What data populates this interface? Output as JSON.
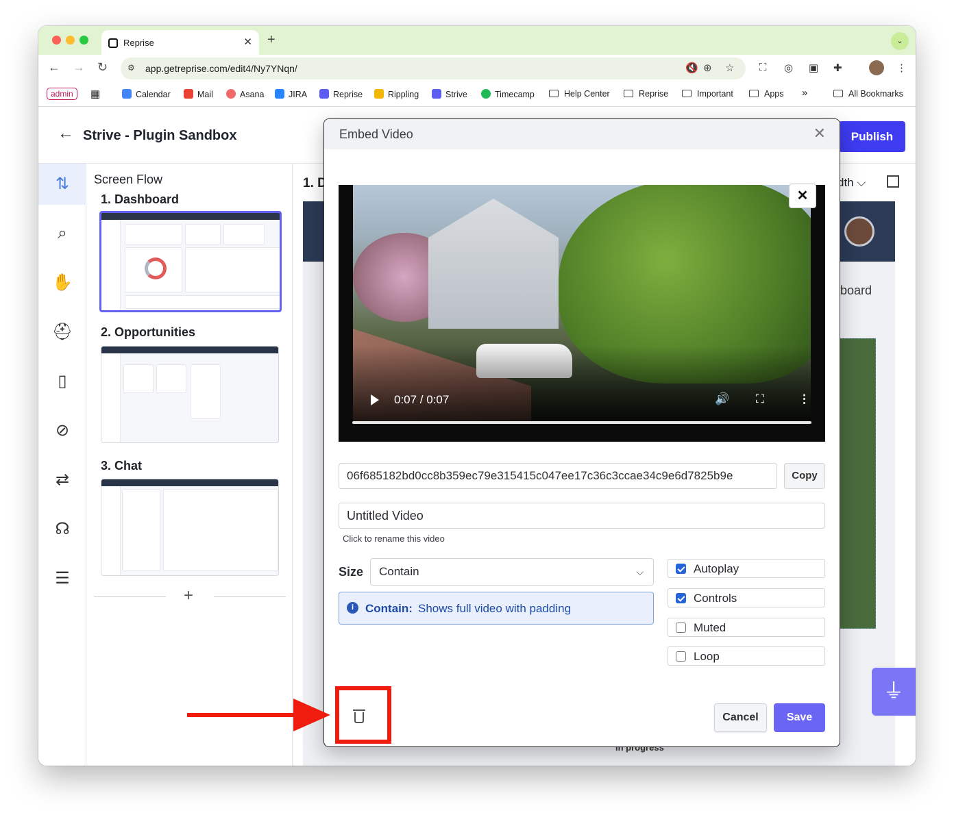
{
  "browser": {
    "tab_title": "Reprise",
    "tab_close": "✕",
    "new_tab": "+",
    "url": "app.getreprise.com/edit4/Ny7YNqn/",
    "bookmarks": [
      {
        "label": "Calendar",
        "icon": "calendar-icon",
        "color": "#4285f4"
      },
      {
        "label": "Mail",
        "icon": "gmail-icon",
        "color": "#ea4335"
      },
      {
        "label": "Asana",
        "icon": "asana-icon",
        "color": "#f06a6a"
      },
      {
        "label": "JIRA",
        "icon": "jira-icon",
        "color": "#2684ff"
      },
      {
        "label": "Reprise",
        "icon": "reprise-icon",
        "color": "#5b5ef0"
      },
      {
        "label": "Rippling",
        "icon": "rippling-icon",
        "color": "#f2b705"
      },
      {
        "label": "Strive",
        "icon": "strive-icon",
        "color": "#5b5ef0"
      },
      {
        "label": "Timecamp",
        "icon": "timecamp-icon",
        "color": "#1db954"
      },
      {
        "label": "Help Center",
        "icon": "folder-icon"
      },
      {
        "label": "Reprise",
        "icon": "folder-icon"
      },
      {
        "label": "Important",
        "icon": "folder-icon"
      },
      {
        "label": "Apps",
        "icon": "folder-icon"
      }
    ],
    "bookmarks_overflow": "»",
    "all_bookmarks": "All Bookmarks",
    "admin_chip": "admin"
  },
  "app": {
    "back": "←",
    "title": "Strive - Plugin Sandbox",
    "publish_label": "Publish",
    "flow_title": "Screen Flow",
    "screens": [
      {
        "label": "1. Dashboard"
      },
      {
        "label": "2. Opportunities"
      },
      {
        "label": "3. Chat"
      }
    ],
    "add_screen": "+",
    "canvas_title": "1. D",
    "canvas_width": "dth ⌵",
    "preview_text": "board",
    "preview_status": "In progress",
    "rail_icons": [
      "reorder-icon",
      "search-icon",
      "hand-shake-icon",
      "helmet-icon",
      "mobile-icon",
      "eye-off-icon",
      "swap-icon",
      "support-icon",
      "list-tree-icon"
    ]
  },
  "modal": {
    "title": "Embed Video",
    "close": "✕",
    "video": {
      "time": "0:07 / 0:07",
      "close_overlay": "✕",
      "volume": "🔊",
      "fullscreen": "⛶",
      "more": "⋮"
    },
    "hash_value": "06f685182bd0cc8b359ec79e315415c047ee17c36c3ccae34c9e6d7825b9e",
    "copy_label": "Copy",
    "name_value": "Untitled Video",
    "rename_hint": "Click to rename this video",
    "size_label": "Size",
    "size_value": "Contain",
    "size_chevron": "⌵",
    "info_icon": "i",
    "info_term": "Contain:",
    "info_desc": "Shows full video with padding",
    "options": [
      {
        "label": "Autoplay",
        "checked": true
      },
      {
        "label": "Controls",
        "checked": true
      },
      {
        "label": "Muted",
        "checked": false
      },
      {
        "label": "Loop",
        "checked": false
      }
    ],
    "cancel_label": "Cancel",
    "save_label": "Save"
  },
  "colors": {
    "accent": "#3e3bf1",
    "save": "#6a65f2",
    "annotation": "#f01d0e",
    "info": "#1e4aa8"
  }
}
